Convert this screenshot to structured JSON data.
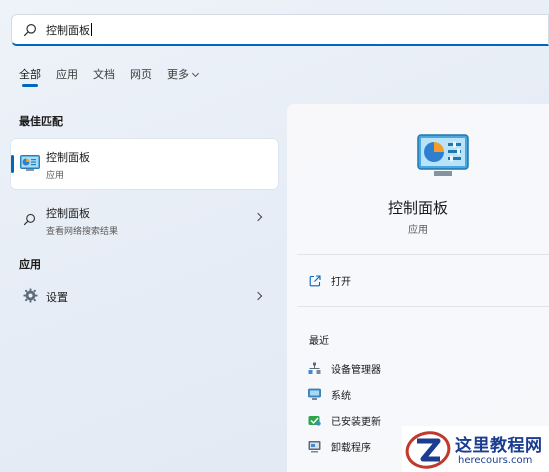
{
  "search": {
    "query": "控制面板"
  },
  "tabs": [
    {
      "label": "全部",
      "active": true
    },
    {
      "label": "应用"
    },
    {
      "label": "文档"
    },
    {
      "label": "网页"
    },
    {
      "label": "更多"
    }
  ],
  "best_match": {
    "section_label": "最佳匹配",
    "title": "控制面板",
    "subtitle": "应用"
  },
  "web_result": {
    "title": "控制面板",
    "subtitle": "查看网络搜索结果"
  },
  "apps": {
    "section_label": "应用",
    "items": [
      {
        "title": "设置"
      }
    ]
  },
  "detail": {
    "title": "控制面板",
    "subtitle": "应用",
    "action_open": "打开",
    "recent_label": "最近",
    "recent": [
      {
        "label": "设备管理器",
        "icon": "device-manager-icon"
      },
      {
        "label": "系统",
        "icon": "system-icon"
      },
      {
        "label": "已安装更新",
        "icon": "installed-updates-icon"
      },
      {
        "label": "卸载程序",
        "icon": "uninstall-program-icon"
      }
    ]
  },
  "watermark": {
    "title": "这里教程网",
    "url": "herecours.com"
  },
  "colors": {
    "accent": "#0067c0",
    "brand_watermark": "#1a3d8f"
  }
}
